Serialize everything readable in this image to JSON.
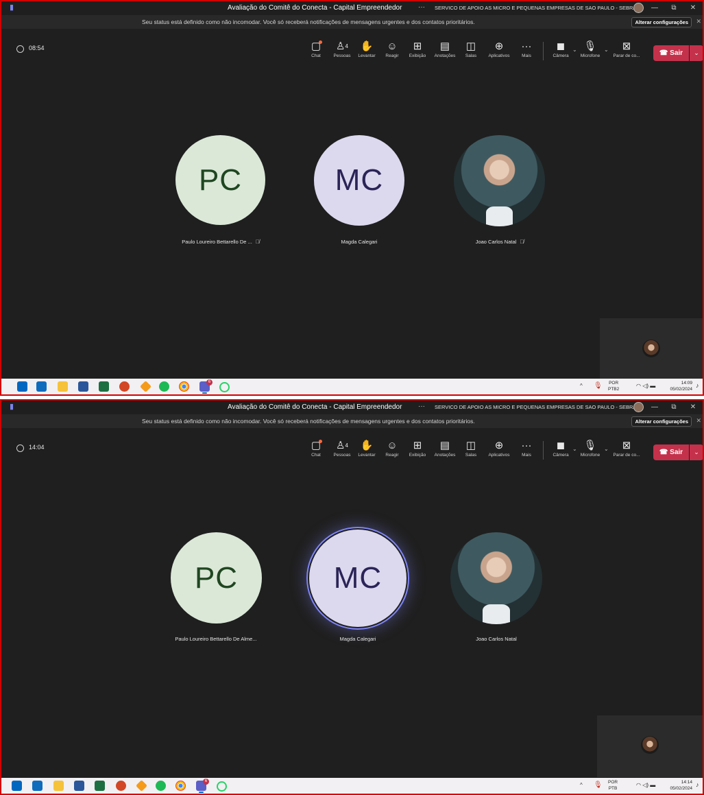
{
  "screens": [
    {
      "window": {
        "title": "Avaliação do Comitê do Conecta - Capital Empreendedor",
        "more": "···",
        "organization": "SERVICO DE APOIO AS MICRO E PEQUENAS EMPRESAS DE SAO PAULO - SEBRAE",
        "minimize": "—",
        "restore": "⧉",
        "close": "✕"
      },
      "notification": {
        "text": "Seu status está definido como não incomodar. Você só receberá notificações de mensagens urgentes e dos contatos prioritários.",
        "button": "Alterar configurações",
        "close": "✕"
      },
      "toolbar": {
        "timer": "08:54",
        "chat": "Chat",
        "people": "Pessoas",
        "people_count": "4",
        "raise": "Levantar",
        "react": "Reagir",
        "view": "Exibição",
        "notes": "Anotações",
        "rooms": "Salas",
        "apps": "Aplicativos",
        "more": "Mais",
        "camera": "Câmera",
        "mic": "Microfone",
        "share": "Parar de co...",
        "leave": "Sair"
      },
      "participants": [
        {
          "initials": "PC",
          "name": "Paulo Loureiro Bettarello De ...",
          "muted": true,
          "speaking": false
        },
        {
          "initials": "MC",
          "name": "Magda Calegari",
          "muted": false,
          "speaking": false
        },
        {
          "initials": "",
          "name": "Joao Carlos Natal",
          "muted": true,
          "speaking": false
        }
      ],
      "taskbar": {
        "language_top": "POR",
        "language_bottom": "PTB2",
        "time": "14:09",
        "date": "05/02/2024",
        "teams_badge": "6"
      }
    },
    {
      "window": {
        "title": "Avaliação do Comitê do Conecta - Capital Empreendedor",
        "more": "···",
        "organization": "SERVICO DE APOIO AS MICRO E PEQUENAS EMPRESAS DE SAO PAULO - SEBRAE",
        "minimize": "—",
        "restore": "⧉",
        "close": "✕"
      },
      "notification": {
        "text": "Seu status está definido como não incomodar. Você só receberá notificações de mensagens urgentes e dos contatos prioritários.",
        "button": "Alterar configurações",
        "close": "✕"
      },
      "toolbar": {
        "timer": "14:04",
        "chat": "Chat",
        "people": "Pessoas",
        "people_count": "4",
        "raise": "Levantar",
        "react": "Reagir",
        "view": "Exibição",
        "notes": "Anotações",
        "rooms": "Salas",
        "apps": "Aplicativos",
        "more": "Mais",
        "camera": "Câmera",
        "mic": "Microfone",
        "share": "Parar de co...",
        "leave": "Sair"
      },
      "participants": [
        {
          "initials": "PC",
          "name": "Paulo Loureiro Bettarello De Alme...",
          "muted": false,
          "speaking": false
        },
        {
          "initials": "MC",
          "name": "Magda Calegari",
          "muted": false,
          "speaking": true
        },
        {
          "initials": "",
          "name": "Joao Carlos Natal",
          "muted": false,
          "speaking": false
        }
      ],
      "taskbar": {
        "language_top": "POR",
        "language_bottom": "PTB",
        "time": "14:14",
        "date": "05/02/2024",
        "teams_badge": "6"
      }
    }
  ],
  "colors": {
    "frame_border": "#d40000",
    "background": "#1f1f1f",
    "leave_button": "#c4314b",
    "speaking_ring": "#7f85f5"
  },
  "icons": {
    "muted": "mic-off-icon",
    "taskbar_apps": [
      "windows-start-icon",
      "outlook-icon",
      "file-explorer-icon",
      "word-icon",
      "excel-icon",
      "powerpoint-icon",
      "snipping-tool-icon",
      "spotify-icon",
      "chrome-icon",
      "teams-icon",
      "whatsapp-icon"
    ]
  }
}
